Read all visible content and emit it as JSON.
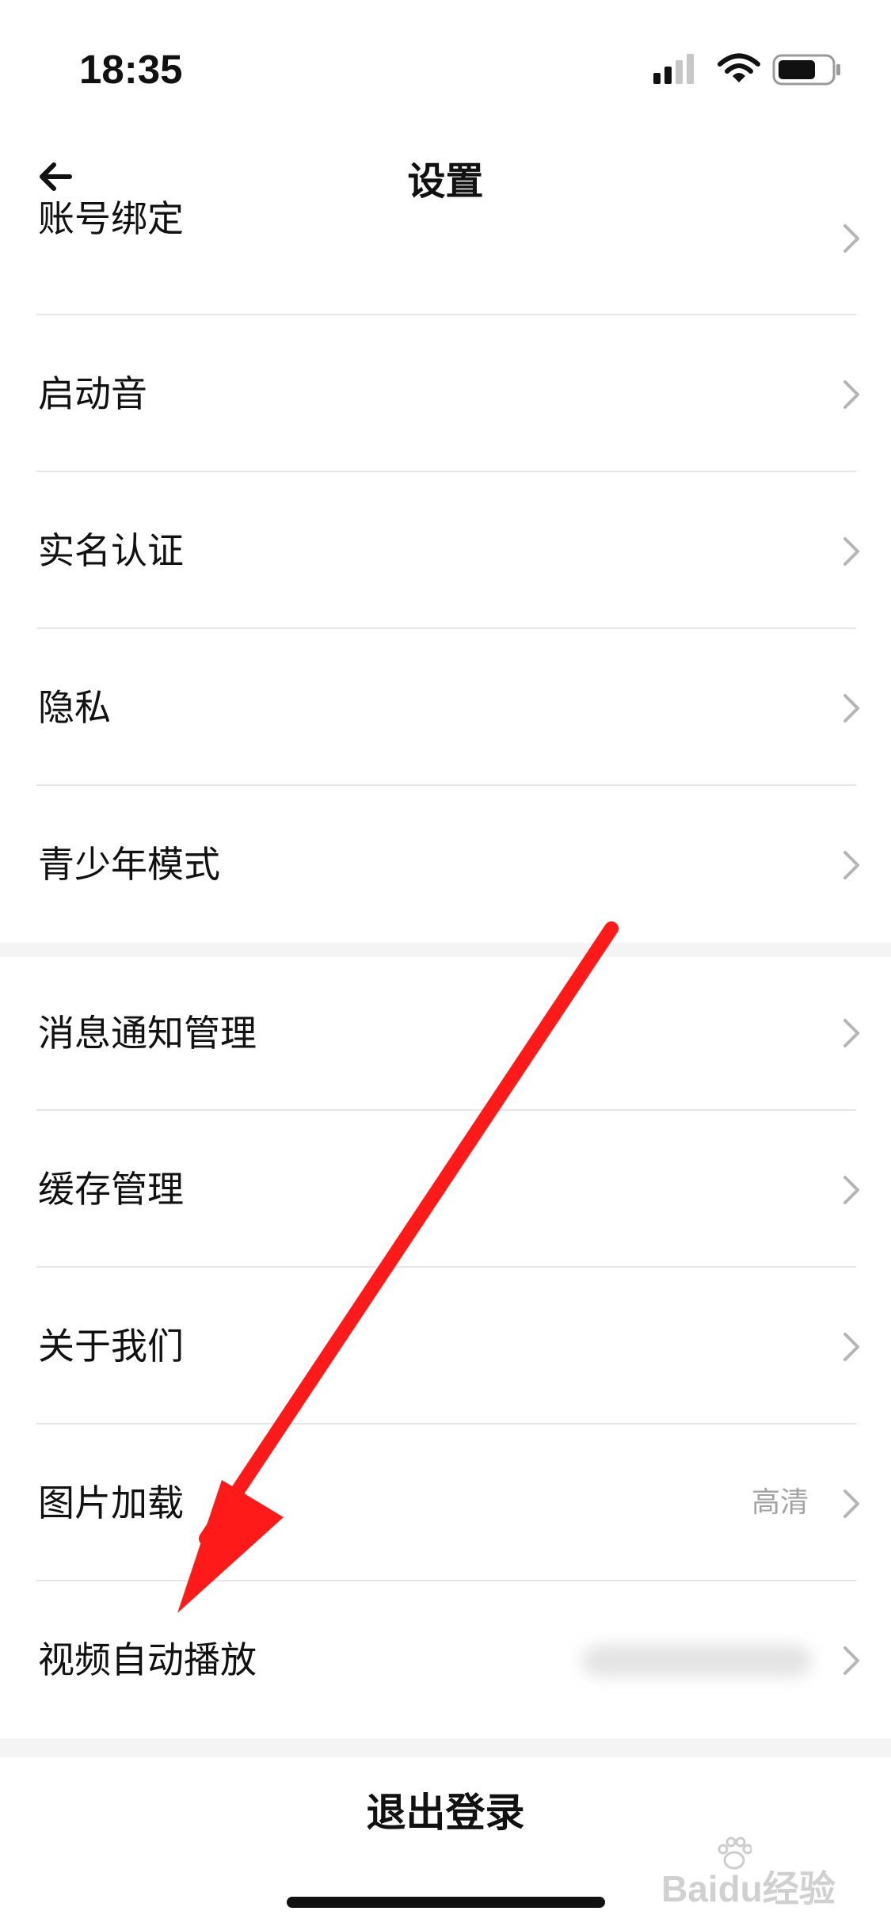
{
  "status_bar": {
    "time": "18:35",
    "icons": [
      "signal-icon",
      "wifi-icon",
      "battery-icon"
    ]
  },
  "nav": {
    "title": "设置",
    "back_icon": "arrow-left-icon"
  },
  "settings": {
    "group1": [
      {
        "label": "账号绑定"
      },
      {
        "label": "启动音"
      },
      {
        "label": "实名认证"
      },
      {
        "label": "隐私"
      },
      {
        "label": "青少年模式"
      }
    ],
    "group2": [
      {
        "label": "消息通知管理"
      },
      {
        "label": "缓存管理"
      },
      {
        "label": "关于我们"
      },
      {
        "label": "图片加载",
        "value": "高清"
      },
      {
        "label": "视频自动播放",
        "value_blurred": true
      }
    ]
  },
  "logout_label": "退出登录",
  "annotation": {
    "type": "red-arrow",
    "color": "#ff1a1a"
  },
  "watermark": {
    "text": "Baidu经验"
  },
  "colors": {
    "background": "#ffffff",
    "divider": "#e6e6e6",
    "gap": "#f4f4f4",
    "chevron": "#b5b5b5",
    "value_text": "#a3a3a3"
  }
}
